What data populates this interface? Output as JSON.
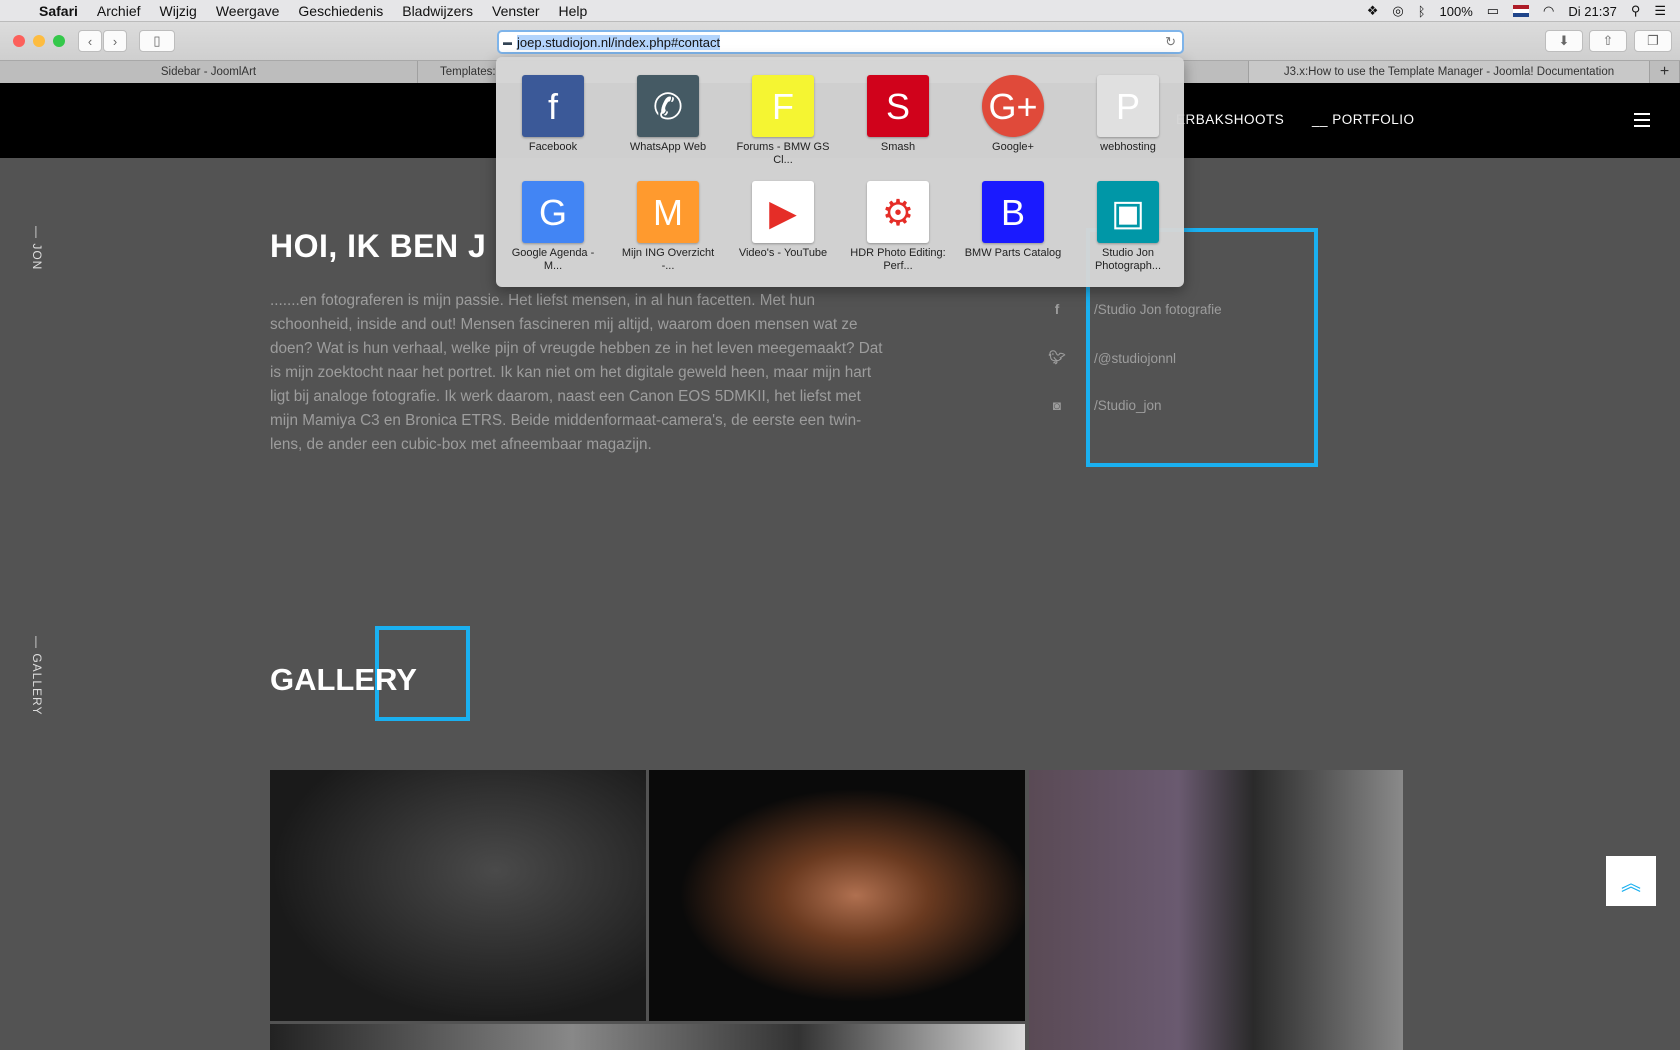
{
  "menubar": {
    "app": "Safari",
    "items": [
      "Archief",
      "Wijzig",
      "Weergave",
      "Geschiedenis",
      "Bladwijzers",
      "Venster",
      "Help"
    ],
    "battery": "100%",
    "clock": "Di 21:37"
  },
  "browser": {
    "url": "joep.studiojon.nl/index.php#contact",
    "tabs": [
      "Sidebar - JoomlArt",
      "Templates:",
      "J3.x:How to use the Template Manager - Joomla! Documentation"
    ],
    "new_tab": "+"
  },
  "favorites": [
    {
      "label": "Facebook",
      "glyph": "f",
      "color": "#3b5998"
    },
    {
      "label": "WhatsApp Web",
      "glyph": "✆",
      "color": "#455a64"
    },
    {
      "label": "Forums - BMW GS Cl...",
      "glyph": "F",
      "color": "#f5f532"
    },
    {
      "label": "Smash",
      "glyph": "S",
      "color": "#d0021b"
    },
    {
      "label": "Google+",
      "glyph": "G+",
      "color": "#e04a3a"
    },
    {
      "label": "webhosting",
      "glyph": "P",
      "color": "#e0e0e0"
    },
    {
      "label": "Google Agenda - M...",
      "glyph": "G",
      "color": "#4285f4"
    },
    {
      "label": "Mijn ING Overzicht -...",
      "glyph": "M",
      "color": "#ff9a2e"
    },
    {
      "label": "Video's - YouTube",
      "glyph": "▶",
      "color": "#ffffff"
    },
    {
      "label": "HDR Photo Editing: Perf...",
      "glyph": "⚙",
      "color": "#ffffff"
    },
    {
      "label": "BMW Parts Catalog",
      "glyph": "B",
      "color": "#1a1aff"
    },
    {
      "label": "Studio Jon Photograph...",
      "glyph": "▣",
      "color": "#0097a7"
    }
  ],
  "site": {
    "nav": [
      "ERBAKSHOOTS",
      "__ PORTFOLIO"
    ],
    "side_labels": [
      "— JON",
      "— GALLERY"
    ],
    "heading": "HOI, IK BEN J",
    "intro": ".......en fotograferen is mijn passie. Het liefst mensen, in al hun facetten. Met hun schoonheid, inside and out! Mensen fascineren mij altijd, waarom doen mensen wat ze doen? Wat is hun verhaal, welke pijn of vreugde hebben ze in het leven meegemaakt? Dat is mijn zoektocht naar het portret. Ik kan niet om het digitale geweld heen, maar mijn hart ligt bij analoge fotografie. Ik werk daarom, naast een Canon EOS 5DMKII, het liefst met mijn Mamiya C3 en Bronica ETRS. Beide middenformaat-camera's, de eerste een twin-lens, de ander een cubic-box met afneembaar magazijn.",
    "social": [
      {
        "icon": "facebook-icon",
        "label": "/Studio Jon fotografie"
      },
      {
        "icon": "twitter-icon",
        "label": "/@studiojonnl"
      },
      {
        "icon": "instagram-icon",
        "label": "/Studio_jon"
      }
    ],
    "gallery_title": "GALLERY",
    "accent": "#1ab0f0"
  }
}
